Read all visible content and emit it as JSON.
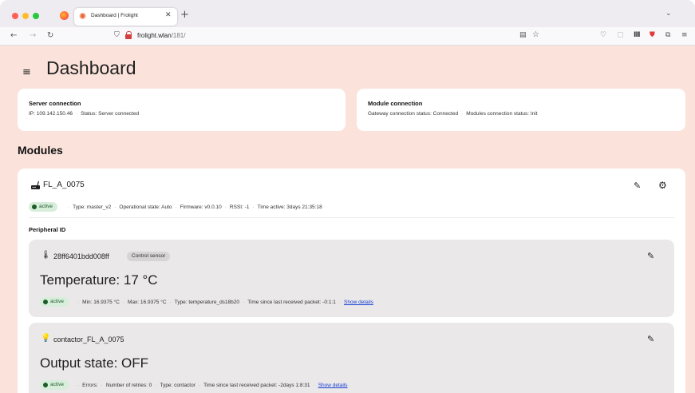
{
  "browser": {
    "tab_title": "Dashboard | Frolight",
    "url_host": "frolight.wlan",
    "url_path": "/181/"
  },
  "page": {
    "title": "Dashboard"
  },
  "server_connection": {
    "title": "Server connection",
    "ip": "IP: 109.142.150.46",
    "status": "Status: Server connected"
  },
  "module_connection": {
    "title": "Module connection",
    "gateway_status": "Gateway connection status: Connected",
    "modules_status": "Modules connection status: Init"
  },
  "modules_section": {
    "title": "Modules"
  },
  "module": {
    "name": "FL_A_0075",
    "status": "active",
    "type": "Type: master_v2",
    "operational_state": "Operational state: Auto",
    "firmware": "Firmware: v0.0.10",
    "rssi": "RSSI: -1",
    "time_active": "Time active: 3days 21:35:18",
    "peripheral_label": "Peripheral ID"
  },
  "peripherals": [
    {
      "name": "28ff6401bdd008ff",
      "chip": "Control sensor",
      "value": "Temperature: 17 °C",
      "status": "active",
      "min": "Min: 16.9375 °C",
      "max": "Max: 16.9375 °C",
      "type": "Type: temperature_ds18b20",
      "last_packet": "Time since last received packet: -0:1:1",
      "details_link": "Show details",
      "icon": "thermometer-icon"
    },
    {
      "name": "contactor_FL_A_0075",
      "value": "Output state: OFF",
      "status": "active",
      "errors": "Errors:",
      "retries": "Number of retries: 0",
      "type": "Type: contactor",
      "last_packet": "Time since last received packet: -2days 1:8:31",
      "details_link": "Show details",
      "icon": "lightbulb-icon"
    }
  ],
  "colors": {
    "page_background": "#fbe3db",
    "card_background": "#ffffff",
    "peripheral_background": "#eae8e8",
    "active_badge": "#d7eedb",
    "active_text": "#1f5a2a",
    "link": "#1a3fd6"
  }
}
